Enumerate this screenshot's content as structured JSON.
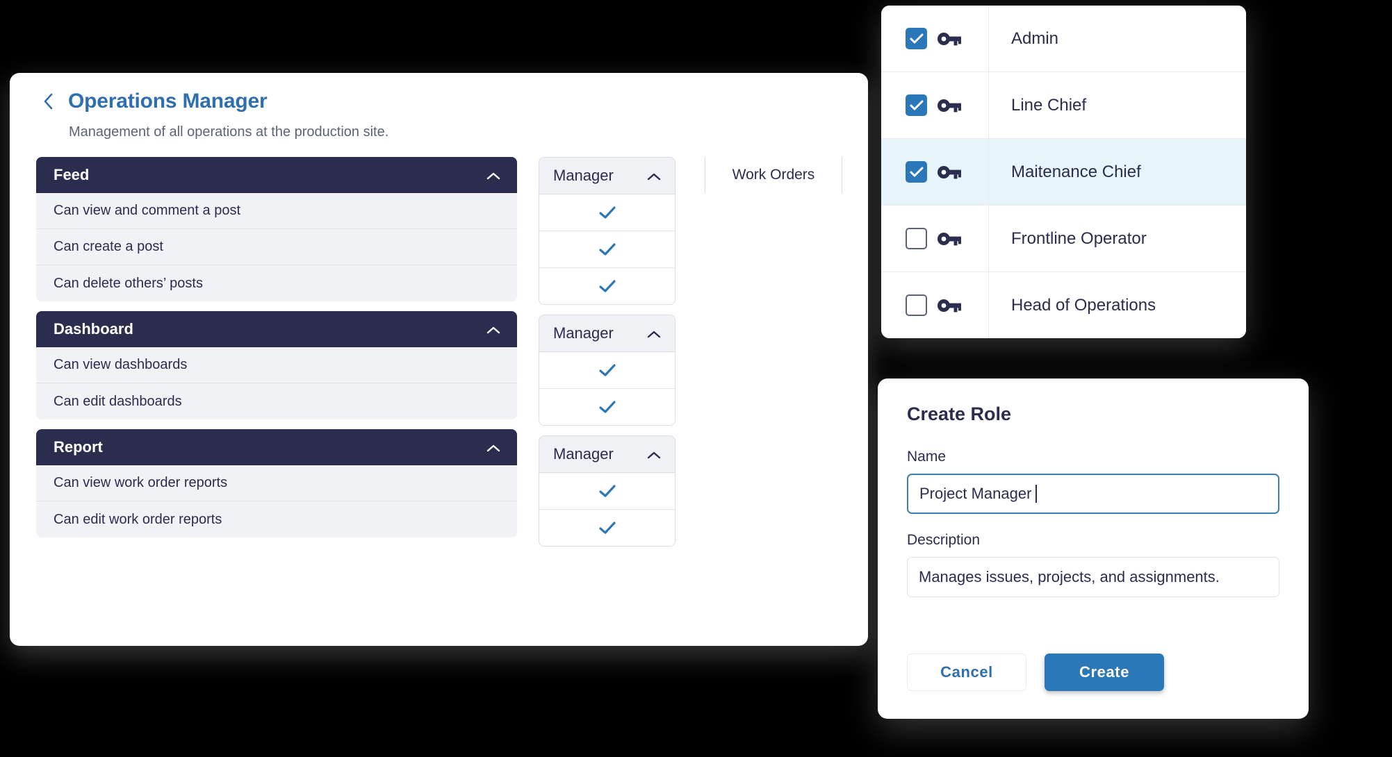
{
  "colors": {
    "section_header_bg": "#2a2d4e",
    "title_blue": "#2f6fad",
    "accent_blue": "#2b77b8",
    "row_bg": "#f1f2f5",
    "selected_row_bg": "#e8f4fc"
  },
  "header": {
    "back_icon": "chevron-left-icon",
    "title": "Operations Manager",
    "subtitle": "Management of all operations at the production site."
  },
  "permissions": {
    "collapse_icon": "chevron-up-icon",
    "check_icon": "check-icon",
    "sections": [
      {
        "name": "Feed",
        "rows": [
          "Can view and comment a post",
          "Can create a post",
          "Can delete others’ posts"
        ]
      },
      {
        "name": "Dashboard",
        "rows": [
          "Can view dashboards",
          "Can edit dashboards"
        ]
      },
      {
        "name": "Report",
        "rows": [
          "Can view work order reports",
          "Can edit work order reports"
        ]
      }
    ],
    "role_columns": [
      {
        "name": "Manager",
        "values": [
          true,
          true,
          true
        ]
      },
      {
        "name": "Manager",
        "values": [
          true,
          true
        ]
      },
      {
        "name": "Manager",
        "values": [
          true,
          true
        ]
      }
    ],
    "partial_column": {
      "name": "Work Orders"
    }
  },
  "roles_dropdown": {
    "key_icon": "key-icon",
    "items": [
      {
        "label": "Admin",
        "checked": true,
        "selected": false
      },
      {
        "label": "Line Chief",
        "checked": true,
        "selected": false
      },
      {
        "label": "Maitenance Chief",
        "checked": true,
        "selected": true
      },
      {
        "label": "Frontline Operator",
        "checked": false,
        "selected": false
      },
      {
        "label": "Head of Operations",
        "checked": false,
        "selected": false
      }
    ]
  },
  "create_dialog": {
    "title": "Create Role",
    "name_label": "Name",
    "name_value": "Project Manager",
    "description_label": "Description",
    "description_value": "Manages issues, projects, and assignments.",
    "cancel_label": "Cancel",
    "create_label": "Create"
  }
}
